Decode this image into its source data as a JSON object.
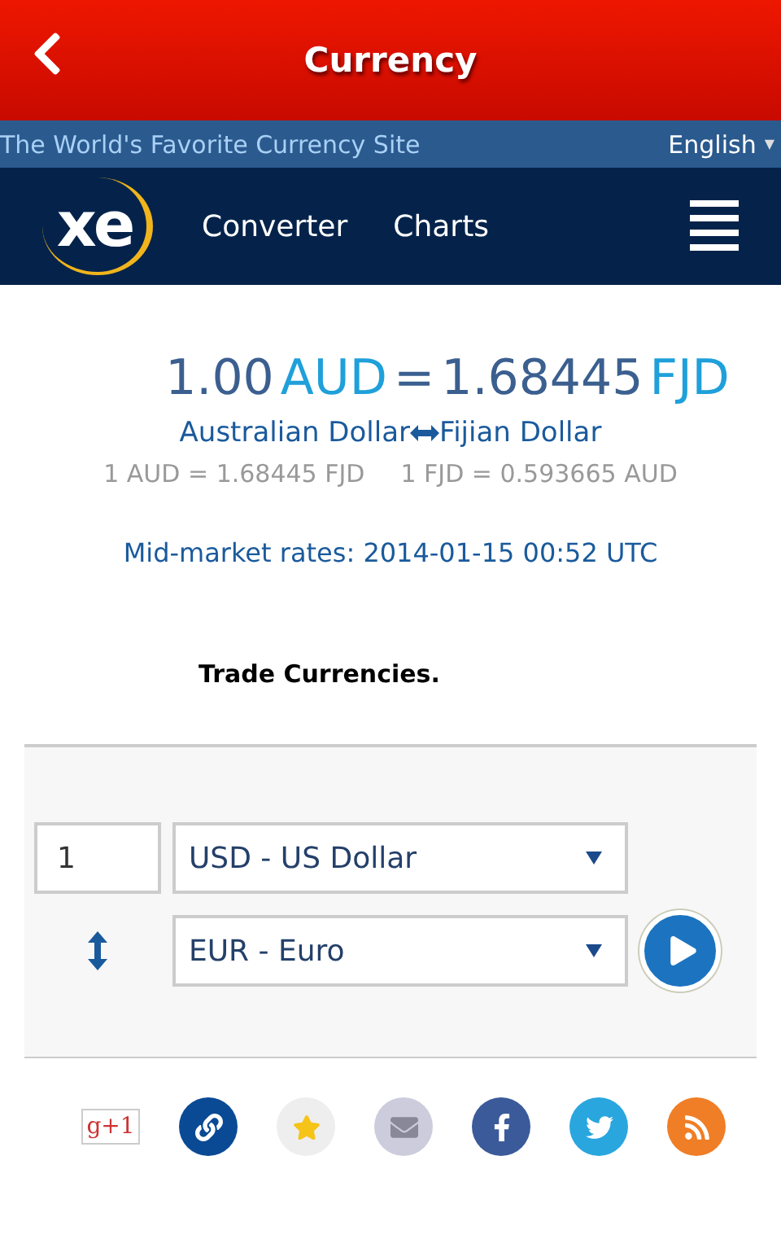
{
  "header": {
    "title": "Currency"
  },
  "tagline_bar": {
    "tagline": "The World's Favorite Currency Site",
    "language": "English",
    "language_caret": "▼"
  },
  "nav": {
    "logo": "xe",
    "links": [
      {
        "label": "Converter"
      },
      {
        "label": "Charts"
      }
    ]
  },
  "conversion": {
    "amount": "1.00",
    "from_code": "AUD",
    "equals": "=",
    "result": "1.68445",
    "to_code": "FJD",
    "from_name": "Australian Dollar",
    "to_name": "Fijian Dollar",
    "rate_from": "1 AUD = 1.68445 FJD",
    "rate_to": "1 FJD = 0.593665 AUD",
    "timestamp": "Mid-market rates: 2014-01-15 00:52 UTC"
  },
  "trade_heading": "Trade Currencies.",
  "converter": {
    "amount": "1",
    "from": "USD - US Dollar",
    "to": "EUR - Euro"
  },
  "share": {
    "gplus": "g+1",
    "buttons": [
      {
        "kind": "link"
      },
      {
        "kind": "favorite"
      },
      {
        "kind": "email"
      },
      {
        "kind": "facebook"
      },
      {
        "kind": "twitter"
      },
      {
        "kind": "rss"
      }
    ]
  }
}
